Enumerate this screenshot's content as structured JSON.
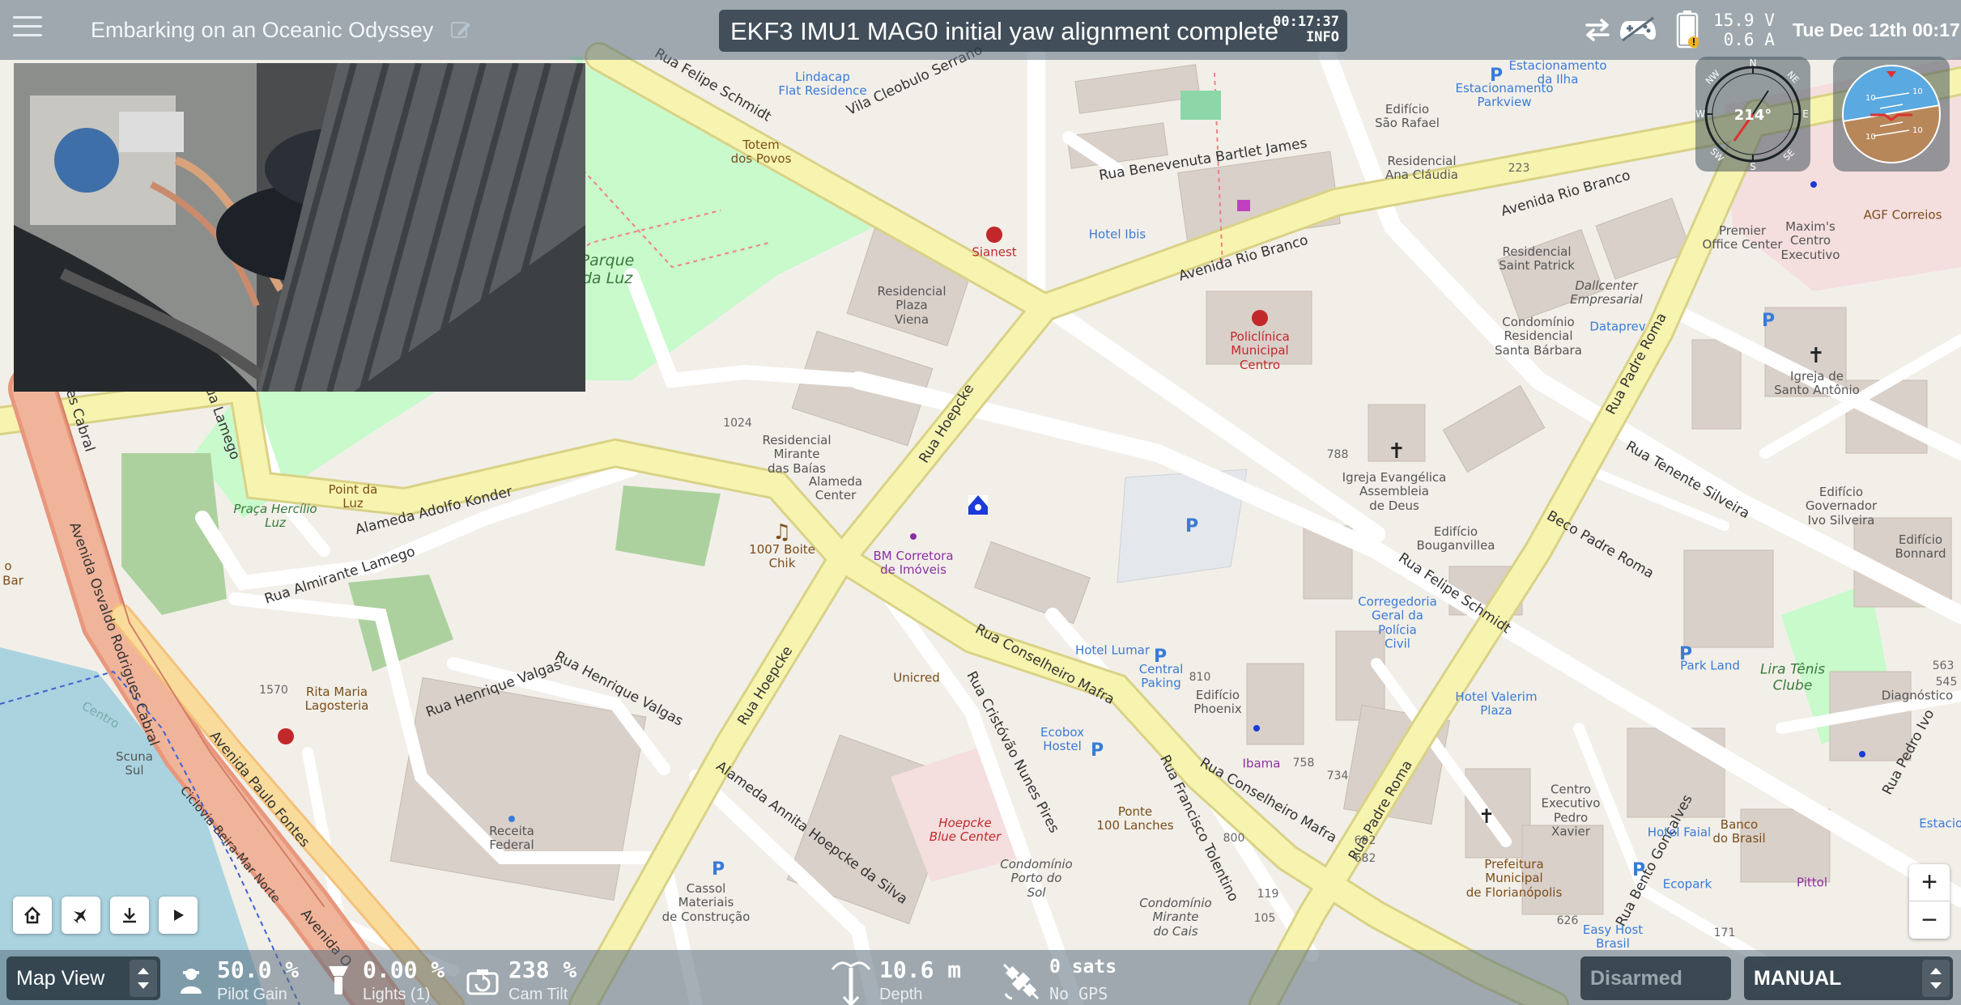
{
  "topbar": {
    "mission_title": "Embarking on an Oceanic Odyssey",
    "status_message": "EKF3 IMU1 MAG0 initial yaw alignment complete",
    "status_time": "00:17:37",
    "status_level": "INFO",
    "battery_voltage": "15.9 V",
    "battery_current": "0.6 A",
    "clock": "Tue Dec 12th 00:17"
  },
  "compass": {
    "heading": "214°",
    "cardinals": {
      "n": "N",
      "ne": "NE",
      "e": "E",
      "se": "SE",
      "s": "S",
      "sw": "SW",
      "w": "W",
      "nw": "NW"
    }
  },
  "attitude": {
    "pitch_marks": [
      "10",
      "10",
      "10",
      "10"
    ]
  },
  "bottombar": {
    "view_selector": "Map View",
    "pilot_gain": {
      "value": "50.0 %",
      "label": "Pilot Gain"
    },
    "lights": {
      "value": "0.00 %",
      "label": "Lights (1)"
    },
    "cam_tilt": {
      "value": "238 %",
      "label": "Cam Tilt"
    },
    "depth": {
      "value": "10.6 m",
      "label": "Depth"
    },
    "gps": {
      "value": "0 sats",
      "label": "No GPS"
    },
    "arm_state": "Disarmed",
    "flight_mode": "MANUAL"
  },
  "map_buttons": {
    "zoom_in": "+",
    "zoom_out": "−"
  },
  "map_labels": {
    "rua_felipe_schmidt": "Rua Felipe Schmidt",
    "vila_cleobulo": "Vila Cleobulo Serrano",
    "lindacap": "Lindacap\nFlat Residence",
    "totem": "Totem\ndos Povos",
    "parque": "Parque\nda Luz",
    "residencial_plaza": "Residencial\nPlaza\nViena",
    "sianest": "Sianest",
    "hotel_ibis": "Hotel Ibis",
    "rua_benevenuta": "Rua Benevenuta Bartlet James",
    "edificio_sao_rafael": "Edifício\nSão Rafael",
    "residencial_ana": "Residencial\nAna Cláudia",
    "estac_ilha": "Estacionamento\nda Ilha",
    "estac_parkview": "Estacionamento\nParkview",
    "avenida_rio_branco_1": "Avenida Rio Branco",
    "avenida_rio_branco_2": "Avenida Rio Branco",
    "num_223": "223",
    "residencial_st_patrick": "Residencial\nSaint Patrick",
    "dallcenter": "Dallcenter\nEmpresarial",
    "premier": "Premier\nOffice Center",
    "maxims": "Maxim's\nCentro\nExecutivo",
    "agf": "AGF Correios",
    "policlinica": "Policlínica\nMunicipal\nCentro",
    "condominio_sb": "Condomínio\nResidencial\nSanta Bárbara",
    "dataprev": "Dataprev",
    "rua_padre_roma_1": "Rua Padre Roma",
    "igreja_sto": "Igreja de\nSanto Antônio",
    "rua_hoepcke_1": "Rua Hoepcke",
    "num_1024": "1024",
    "residencial_mirante": "Residencial\nMirante\ndas Baías",
    "alameda_center": "Alameda\nCenter",
    "alameda_adolfo": "Alameda Adolfo Konder",
    "point_luz": "Point da\nLuz",
    "praca_hercilio": "Praça Hercílio\nLuz",
    "rua_almirante": "Rua Almirante Lamego",
    "boite_chik": "1007 Boite\nChik",
    "bm_corretora": "BM Corretora\nde Imóveis",
    "num_788": "788",
    "igreja_evangelica": "Igreja Evangélica\nAssembleia\nde Deus",
    "edificio_bouganvillea": "Edifício\nBouganvillea",
    "beco_padre_roma": "Beco Padre Roma",
    "rua_tenente_silveira": "Rua Tenente Silveira",
    "edificio_governador": "Edifício\nGovernador\nIvo Silveira",
    "edificio_bonnard": "Edifício\nBonnard",
    "rua_felipe_schmidt_2": "Rua Felipe Schmidt",
    "corregedoria": "Corregedoria\nGeral da\nPolícia\nCivil",
    "hotel_lumar": "Hotel Lumar",
    "central_paking": "Central\nPaking",
    "num_810": "810",
    "edificio_phoenix": "Edifício\nPhoenix",
    "rua_conselheiro_mafra_1": "Rua Conselheiro Mafra",
    "unicred": "Unicred",
    "ecobox": "Ecobox\nHostel",
    "rua_cristovao": "Rua Cristóvão Nunes Pires",
    "hotel_valerim": "Hotel Valerim\nPlaza",
    "park_land": "Park Land",
    "lira_tenis": "Lira Tênis\nClube",
    "num_563": "563",
    "num_545": "545",
    "diagnostico": "Diagnóstico",
    "rua_pedro_ivo": "Rua Pedro Ivo",
    "estacion": "Estacion",
    "av_osvaldo": "Avenida Osvaldo Rodrigues Cabral",
    "rua_lamego": "Rua Lamego",
    "num_1570": "1570",
    "rita_maria": "Rita Maria\nLagosteria",
    "rua_henrique_valgas_1": "Rua Henrique Valgas",
    "rua_henrique_valgas_2": "Rua Henrique Valgas",
    "receita_federal": "Receita\nFederal",
    "scuna_sul": "Scuna\nSul",
    "centro": "Centro",
    "av_paulo_fontes": "Avenida Paulo Fontes",
    "ciclovia": "Ciclovia Beira-Mar Norte",
    "rua_hoepcke_2": "Rua Hoepcke",
    "alameda_annita": "Alameda Annita Hoepcke da Silva",
    "cassol": "Cassol\nMateriais\nde Construção",
    "hoepcke_blue": "Hoepcke\nBlue Center",
    "condominio_porto": "Condomínio\nPorto do\nSol",
    "ponte_lanches": "Ponte\n100 Lanches",
    "rua_francisco": "Rua Francisco Tolentino",
    "ibama": "Ibama",
    "num_758": "758",
    "num_734": "734",
    "rua_conselheiro_mafra_2": "Rua Conselheiro Mafra",
    "rua_padre_roma_2": "Rua Padre Roma",
    "num_800": "800",
    "num_692": "692",
    "num_682": "682",
    "num_119": "119",
    "num_105": "105",
    "condominio_cais": "Condomínio\nMirante\ndo Cais",
    "centro_executivo": "Centro\nExecutivo\nPedro\nXavier",
    "prefeitura": "Prefeitura\nMunicipal\nde Florianópolis",
    "rua_bento": "Rua Bento Gonçalves",
    "hotel_faial": "Hotel Faial",
    "banco_brasil": "Banco\ndo Brasil",
    "ecopark": "Ecopark",
    "pittol": "Pittol",
    "easy_host": "Easy Host\nBrasil",
    "num_626": "626",
    "num_171": "171",
    "bar": "Bar",
    "o_label": "o",
    "ces_cabral": "es Cabral",
    "avenida_o": "Avenida O"
  }
}
